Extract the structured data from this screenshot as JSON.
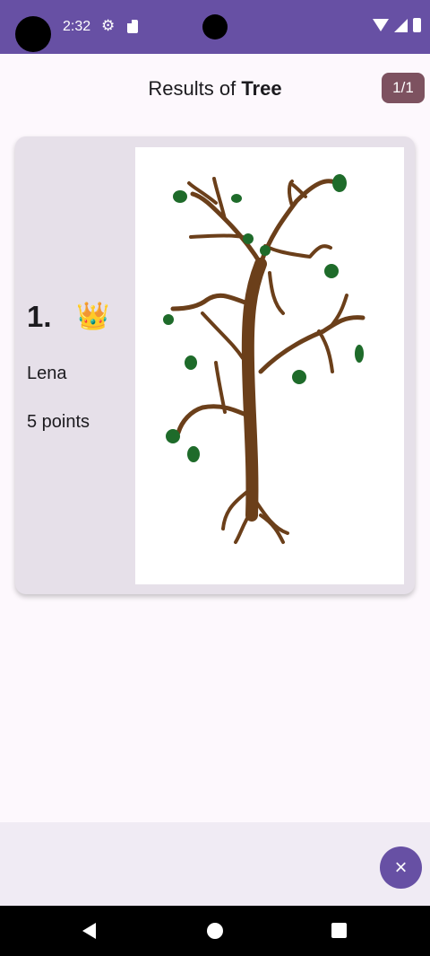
{
  "status_bar": {
    "time": "2:32",
    "icons": [
      "settings-icon",
      "sd-card-icon",
      "wifi-icon",
      "signal-icon",
      "battery-icon"
    ],
    "color": "#6750a4"
  },
  "header": {
    "title_prefix": "Results of ",
    "title_word": "Tree",
    "page_indicator": "1/1",
    "badge_color": "#7d5260"
  },
  "result": {
    "rank": "1.",
    "crown": "👑",
    "player": "Lena",
    "points": "5 points",
    "drawing_subject": "tree"
  },
  "actions": {
    "close_icon": "×"
  },
  "nav_bar": {
    "icons": [
      "back-icon",
      "home-icon",
      "recents-icon"
    ]
  }
}
